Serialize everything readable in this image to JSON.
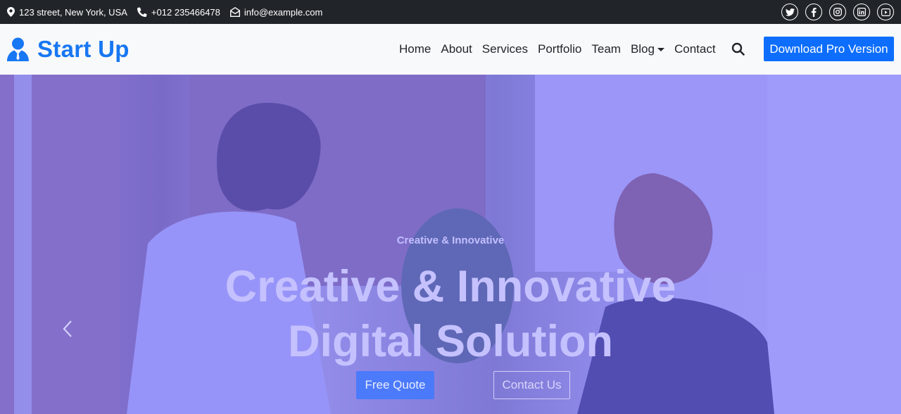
{
  "topbar": {
    "address": "123 street, New York, USA",
    "phone": "+012 235466478",
    "email": "info@example.com",
    "social_icons": [
      "twitter-icon",
      "facebook-icon",
      "instagram-icon",
      "linkedin-icon",
      "youtube-icon"
    ]
  },
  "navbar": {
    "brand": "Start Up",
    "links": [
      "Home",
      "About",
      "Services",
      "Portfolio",
      "Team",
      "Blog",
      "Contact"
    ],
    "cta": "Download Pro Version"
  },
  "hero": {
    "subtitle": "Creative & Innovative",
    "title_line1": "Creative & Innovative",
    "title_line2": "Digital Solution",
    "primary_button": "Free Quote",
    "secondary_button": "Contact Us"
  },
  "colors": {
    "topbar_bg": "#212529",
    "navbar_bg": "#f8f9fa",
    "brand": "#1877f2",
    "primary": "#0d6efd",
    "hero_overlay": "#625bff"
  }
}
